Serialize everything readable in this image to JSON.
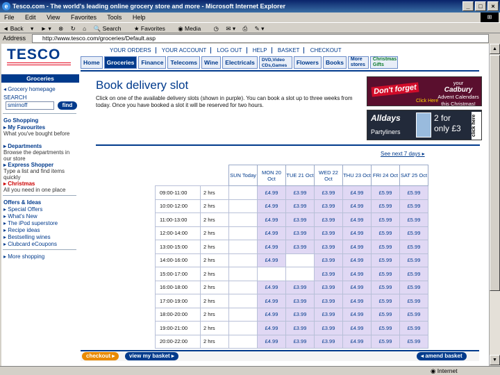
{
  "window": {
    "title": "Tesco.com - The world's leading online grocery store and more - Microsoft Internet Explorer",
    "controls": {
      "minimize": "_",
      "maximize": "□",
      "close": "×"
    }
  },
  "menu": [
    "File",
    "Edit",
    "View",
    "Favorites",
    "Tools",
    "Help"
  ],
  "toolbar": {
    "back": "Back",
    "search": "Search",
    "favorites": "Favorites",
    "media": "Media"
  },
  "address": {
    "label": "Address",
    "url": "http://www.tesco.com/groceries/Default.asp"
  },
  "site": {
    "logo": "TESCO",
    "topnav": [
      "YOUR ORDERS",
      "YOUR ACCOUNT",
      "LOG OUT",
      "HELP",
      "BASKET",
      "CHECKOUT"
    ],
    "tabs": [
      "Home",
      "Groceries",
      "Finance",
      "Telecoms",
      "Wine",
      "Electricals",
      "DVD,Video CDs,Games",
      "Flowers",
      "Books",
      "More stores",
      "Christmas Gifts"
    ],
    "active_tab": "Groceries"
  },
  "sidebar": {
    "header": "Groceries",
    "home_link": "Grocery homepage",
    "search_label": "SEARCH",
    "search_value": "smirnoff",
    "find_button": "find",
    "go_shopping": "Go Shopping",
    "favourites_title": "My Favourites",
    "favourites_desc": "What you've bought before",
    "departments_title": "Departments",
    "departments_desc": "Browse the departments in our store",
    "express_title": "Express Shopper",
    "express_desc": "Type a list and find items quickly",
    "christmas_title": "Christmas",
    "christmas_desc": "All you need in one place",
    "offers_title": "Offers & Ideas",
    "links": [
      "Special Offers",
      "What's New",
      "The iPod superstore",
      "Recipe ideas",
      "Bestselling wines",
      "Clubcard eCoupons"
    ],
    "more": "More shopping"
  },
  "page": {
    "title": "Book delivery slot",
    "intro": "Click on one of the available delivery slots (shown in purple). You can book a slot up to three weeks from today. Once you have booked a slot it will be reserved for two hours.",
    "see_next": "See next 7 days"
  },
  "promos": {
    "cadbury": {
      "headline": "Don't forget",
      "brand": "Cadbury",
      "line1": "your",
      "line2": "Advent Calendars",
      "line3": "this Christmas!",
      "cta": "Click Here"
    },
    "alldays": {
      "brand": "Alldays",
      "product": "Partyliners",
      "offer1": "2 for",
      "offer2": "only £3",
      "cta": "click here"
    }
  },
  "slots": {
    "columns": [
      "SUN Today",
      "MON 20 Oct",
      "TUE 21 Oct",
      "WED 22 Oct",
      "THU 23 Oct",
      "FRI 24 Oct",
      "SAT 25 Oct"
    ],
    "rows": [
      {
        "time": "09:00-11:00",
        "dur": "2 hrs",
        "cells": [
          "",
          "£4.99",
          "£3.99",
          "£3.99",
          "£4.99",
          "£5.99",
          "£5.99"
        ]
      },
      {
        "time": "10:00-12:00",
        "dur": "2 hrs",
        "cells": [
          "",
          "£4.99",
          "£3.99",
          "£3.99",
          "£4.99",
          "£5.99",
          "£5.99"
        ]
      },
      {
        "time": "11:00-13:00",
        "dur": "2 hrs",
        "cells": [
          "",
          "£4.99",
          "£3.99",
          "£3.99",
          "£4.99",
          "£5.99",
          "£5.99"
        ]
      },
      {
        "time": "12:00-14:00",
        "dur": "2 hrs",
        "cells": [
          "",
          "£4.99",
          "£3.99",
          "£3.99",
          "£4.99",
          "£5.99",
          "£5.99"
        ]
      },
      {
        "time": "13:00-15:00",
        "dur": "2 hrs",
        "cells": [
          "",
          "£4.99",
          "£3.99",
          "£3.99",
          "£4.99",
          "£5.99",
          "£5.99"
        ]
      },
      {
        "time": "14:00-16:00",
        "dur": "2 hrs",
        "cells": [
          "",
          "£4.99",
          "",
          "£3.99",
          "£4.99",
          "£5.99",
          "£5.99"
        ]
      },
      {
        "time": "15:00-17:00",
        "dur": "2 hrs",
        "cells": [
          "",
          "",
          "",
          "£3.99",
          "£4.99",
          "£5.99",
          "£5.99"
        ]
      },
      {
        "time": "16:00-18:00",
        "dur": "2 hrs",
        "cells": [
          "",
          "£4.99",
          "£3.99",
          "£3.99",
          "£4.99",
          "£5.99",
          "£5.99"
        ]
      },
      {
        "time": "17:00-19:00",
        "dur": "2 hrs",
        "cells": [
          "",
          "£4.99",
          "£3.99",
          "£3.99",
          "£4.99",
          "£5.99",
          "£5.99"
        ]
      },
      {
        "time": "18:00-20:00",
        "dur": "2 hrs",
        "cells": [
          "",
          "£4.99",
          "£3.99",
          "£3.99",
          "£4.99",
          "£5.99",
          "£5.99"
        ]
      },
      {
        "time": "19:00-21:00",
        "dur": "2 hrs",
        "cells": [
          "",
          "£4.99",
          "£3.99",
          "£3.99",
          "£4.99",
          "£5.99",
          "£5.99"
        ]
      },
      {
        "time": "20:00-22:00",
        "dur": "2 hrs",
        "cells": [
          "",
          "£4.99",
          "£3.99",
          "£3.99",
          "£4.99",
          "£5.99",
          "£5.99"
        ]
      }
    ]
  },
  "buttons": {
    "checkout": "checkout",
    "my_basket": "view my basket",
    "amend": "amend basket"
  },
  "status": {
    "zone": "Internet"
  },
  "colors": {
    "brand_blue": "#003a8c",
    "slot_purple": "#e0d8f4",
    "accent_red": "#e2001a"
  }
}
